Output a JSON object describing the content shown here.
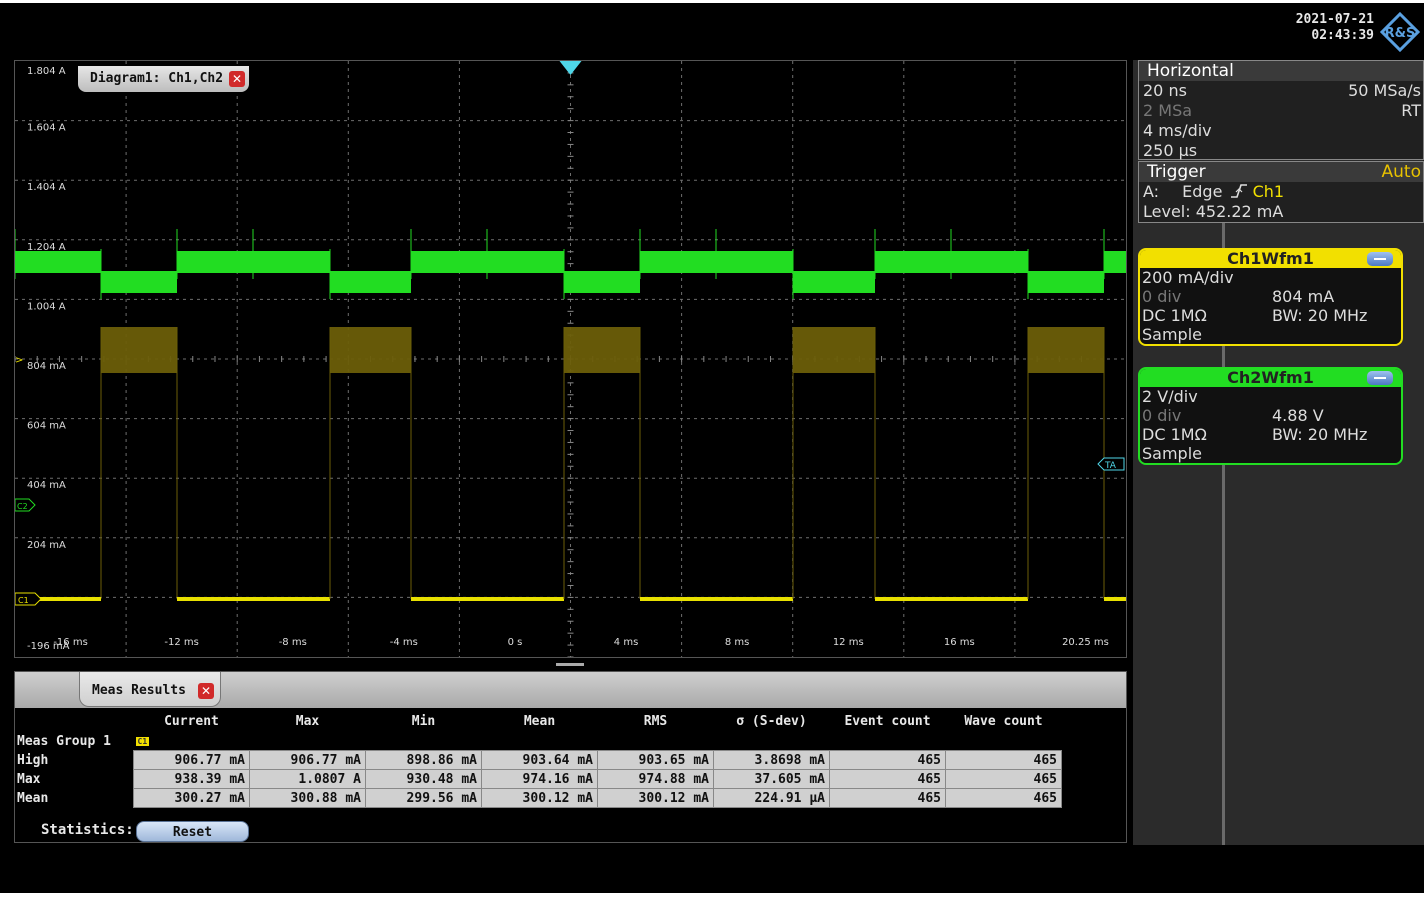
{
  "header": {
    "date": "2021-07-21",
    "time": "02:43:39",
    "brand_logo": "R&S"
  },
  "diagram": {
    "tab_title": "Diagram1: Ch1,Ch2",
    "y_labels": [
      "1.804 A",
      "1.604 A",
      "1.404 A",
      "1.204 A",
      "1.004 A",
      "804 mA",
      "604 mA",
      "404 mA",
      "204 mA",
      "-196 mA"
    ],
    "x_labels": [
      "-16 ms",
      "-12 ms",
      "-8 ms",
      "-4 ms",
      "0 s",
      "4 ms",
      "8 ms",
      "12 ms",
      "16 ms",
      "20.25 ms"
    ],
    "markers": {
      "ch1": "C1",
      "ch2": "C2",
      "trigger": "TA",
      "offset_marker": ">"
    },
    "colors": {
      "ch1": "#e8e000",
      "ch2": "#22dd22",
      "grid": "#6e6e6e",
      "trigger": "#4fd6e8"
    }
  },
  "meas": {
    "tab_title": "Meas Results",
    "columns": [
      "",
      "Current",
      "Max",
      "Min",
      "Mean",
      "RMS",
      "σ (S-dev)",
      "Event count",
      "Wave count"
    ],
    "group_label": "Meas Group 1",
    "group_badge": "C1",
    "rows": [
      {
        "label": "High",
        "values": [
          "906.77 mA",
          "906.77 mA",
          "898.86 mA",
          "903.64 mA",
          "903.65 mA",
          "3.8698 mA",
          "465",
          "465"
        ]
      },
      {
        "label": "Max",
        "values": [
          "938.39 mA",
          "1.0807 A",
          "930.48 mA",
          "974.16 mA",
          "974.88 mA",
          "37.605 mA",
          "465",
          "465"
        ]
      },
      {
        "label": "Mean",
        "values": [
          "300.27 mA",
          "300.88 mA",
          "299.56 mA",
          "300.12 mA",
          "300.12 mA",
          "224.91 µA",
          "465",
          "465"
        ]
      }
    ],
    "statistics_label": "Statistics:",
    "reset_label": "Reset"
  },
  "horizontal": {
    "title": "Horizontal",
    "resolution": "20 ns",
    "sample_rate": "50 MSa/s",
    "record_length": "2 MSa",
    "mode": "RT",
    "time_scale": "4 ms/div",
    "position": "250 µs"
  },
  "trigger": {
    "title": "Trigger",
    "mode": "Auto",
    "source_prefix": "A:",
    "type": "Edge",
    "source": "Ch1",
    "level": "Level: 452.22 mA"
  },
  "ch1wfm": {
    "title": "Ch1Wfm1",
    "scale": "200 mA/div",
    "offset_div": "0 div",
    "offset_val": "804 mA",
    "coupling": "DC 1MΩ",
    "bandwidth": "BW: 20 MHz",
    "acq": "Sample",
    "color": "#f2e000"
  },
  "ch2wfm": {
    "title": "Ch2Wfm1",
    "scale": "2 V/div",
    "offset_div": "0 div",
    "offset_val": "4.88 V",
    "coupling": "DC 1MΩ",
    "bandwidth": "BW: 20 MHz",
    "acq": "Sample",
    "color": "#22dd22"
  }
}
